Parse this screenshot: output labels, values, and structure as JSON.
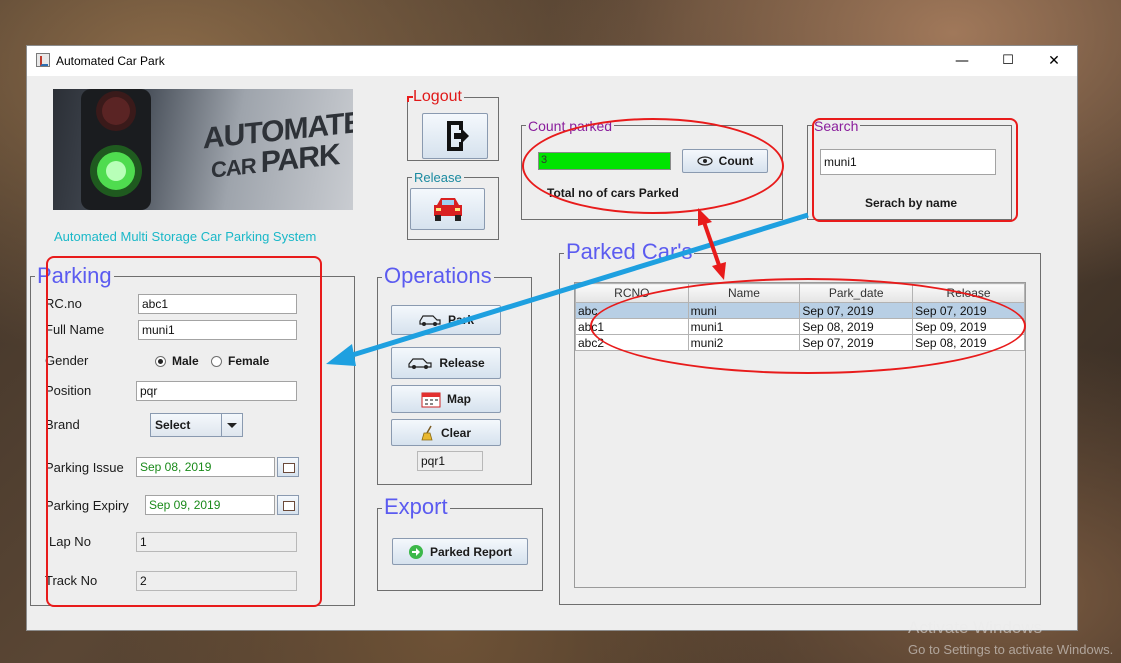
{
  "window": {
    "title": "Automated Car Park",
    "controls": {
      "minimize": "—",
      "maximize": "☐",
      "close": "✕"
    }
  },
  "banner": {
    "line1": "AUTOMATED",
    "line2": "CAR",
    "line3": "PARK",
    "subtitle": "Automated Multi Storage Car Parking System"
  },
  "logout": {
    "legend": "Logout"
  },
  "release_box": {
    "legend": "Release"
  },
  "count_parked": {
    "legend": "Count parked",
    "value": "3",
    "count_button": "Count",
    "caption": "Total no of cars Parked",
    "progress_fraction": 1.0,
    "progress_color": "#00e400"
  },
  "search": {
    "legend": "Search",
    "value": "muni1",
    "caption": "Serach by name"
  },
  "parking": {
    "legend": "Parking",
    "rc_label": "RC.no",
    "rc_value": "abc1",
    "fullname_label": "Full Name",
    "fullname_value": "muni1",
    "gender_label": "Gender",
    "gender_male": "Male",
    "gender_female": "Female",
    "position_label": "Position",
    "position_value": "pqr",
    "brand_label": "Brand",
    "brand_value": "Select",
    "issue_label": "Parking Issue",
    "issue_value": "Sep 08, 2019",
    "expiry_label": "Parking Expiry",
    "expiry_value": "Sep 09, 2019",
    "lap_label": "Lap No",
    "lap_value": "1",
    "track_label": "Track No",
    "track_value": "2"
  },
  "operations": {
    "legend": "Operations",
    "park_button": "Park",
    "release_button": "Release",
    "map_button": "Map",
    "clear_button": "Clear",
    "position_value": "pqr1"
  },
  "export": {
    "legend": "Export",
    "report_button": "Parked Report"
  },
  "parked_cars": {
    "legend": "Parked Car's",
    "columns": [
      "RCNO",
      "Name",
      "Park_date",
      "Release"
    ],
    "rows": [
      [
        "abc",
        "muni",
        "Sep 07, 2019",
        "Sep 07, 2019"
      ],
      [
        "abc1",
        "muni1",
        "Sep 08, 2019",
        "Sep 09, 2019"
      ],
      [
        "abc2",
        "muni2",
        "Sep 07, 2019",
        "Sep 08, 2019"
      ]
    ]
  },
  "watermark": {
    "line1": "Activate Windows",
    "line2": "Go to Settings to activate Windows."
  },
  "colors": {
    "legend_purple": "#8a1e9c",
    "legend_blue": "#5b5bf0",
    "legend_red": "#e01818",
    "subtitle_cyan": "#1ab8c8",
    "annotation_red": "#e81b1b",
    "arrow_blue": "#1ea0e0"
  }
}
